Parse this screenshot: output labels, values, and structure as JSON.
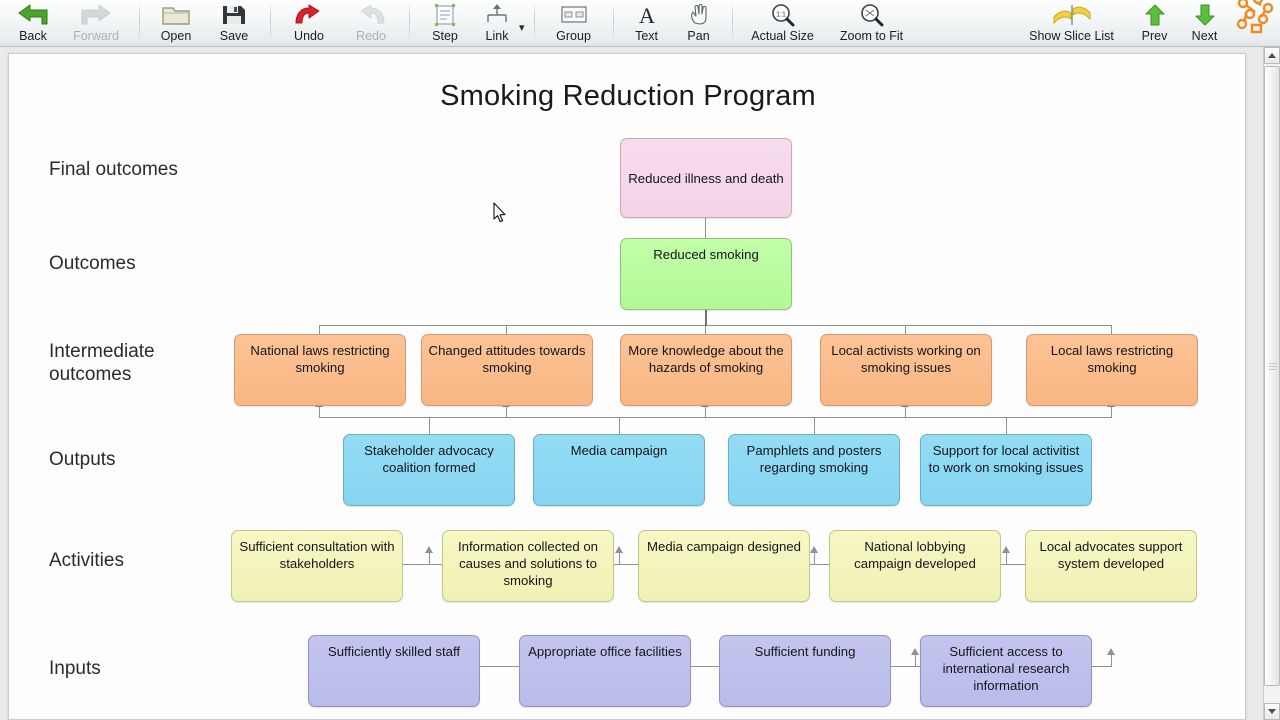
{
  "toolbar": {
    "items": [
      {
        "label": "Back",
        "icon": "back-arrow-icon",
        "disabled": false
      },
      {
        "label": "Forward",
        "icon": "forward-arrow-icon",
        "disabled": true
      },
      {
        "label": "Open",
        "icon": "folder-open-icon",
        "disabled": false
      },
      {
        "label": "Save",
        "icon": "floppy-disk-icon",
        "disabled": false
      },
      {
        "label": "Undo",
        "icon": "undo-arrow-icon",
        "disabled": false
      },
      {
        "label": "Redo",
        "icon": "redo-arrow-icon",
        "disabled": true
      },
      {
        "label": "Step",
        "icon": "step-icon",
        "disabled": false
      },
      {
        "label": "Link",
        "icon": "link-icon",
        "disabled": false
      },
      {
        "label": "Group",
        "icon": "group-icon",
        "disabled": false
      },
      {
        "label": "Text",
        "icon": "text-a-icon",
        "disabled": false
      },
      {
        "label": "Pan",
        "icon": "pan-hand-icon",
        "disabled": false
      },
      {
        "label": "Actual Size",
        "icon": "actual-size-icon",
        "disabled": false
      },
      {
        "label": "Zoom to Fit",
        "icon": "zoom-to-fit-icon",
        "disabled": false
      },
      {
        "label": "Show Slice List",
        "icon": "slice-list-icon",
        "disabled": false
      },
      {
        "label": "Prev",
        "icon": "up-arrow-green-icon",
        "disabled": false
      },
      {
        "label": "Next",
        "icon": "down-arrow-green-icon",
        "disabled": false
      }
    ],
    "link_dropdown_caret": "▾"
  },
  "diagram": {
    "title": "Smoking Reduction Program",
    "row_labels": [
      {
        "text": "Final outcomes"
      },
      {
        "text": "Outcomes"
      },
      {
        "text": "Intermediate\noutcomes"
      },
      {
        "text": "Outputs"
      },
      {
        "text": "Activities"
      },
      {
        "text": "Inputs"
      }
    ],
    "final_outcomes": [
      {
        "text": "Reduced illness and death"
      }
    ],
    "outcomes": [
      {
        "text": "Reduced smoking"
      }
    ],
    "intermediate_outcomes": [
      {
        "text": "National laws restricting smoking"
      },
      {
        "text": "Changed attitudes towards smoking"
      },
      {
        "text": "More knowledge about the hazards of smoking"
      },
      {
        "text": "Local activists working on smoking issues"
      },
      {
        "text": "Local laws restricting smoking"
      }
    ],
    "outputs": [
      {
        "text": "Stakeholder advocacy coalition formed"
      },
      {
        "text": "Media campaign"
      },
      {
        "text": "Pamphlets and posters regarding smoking"
      },
      {
        "text": "Support for local activitist to work on smoking issues"
      }
    ],
    "activities": [
      {
        "text": "Sufficient consultation with stakeholders"
      },
      {
        "text": "Information collected on causes and solutions to smoking"
      },
      {
        "text": "Media campaign designed"
      },
      {
        "text": "National lobbying campaign developed"
      },
      {
        "text": "Local advocates support system developed"
      }
    ],
    "inputs": [
      {
        "text": "Sufficiently skilled staff"
      },
      {
        "text": "Appropriate office facilities"
      },
      {
        "text": "Sufficient funding"
      },
      {
        "text": "Sufficient access to international research information"
      }
    ],
    "colors": {
      "final_outcomes": "#f5d9ea",
      "outcomes": "#b9fba0",
      "intermediate_outcomes": "#fabb8b",
      "outputs": "#8bd8f3",
      "activities": "#f2f4ba",
      "inputs": "#bec1ec",
      "connector": "#8d9296"
    }
  }
}
